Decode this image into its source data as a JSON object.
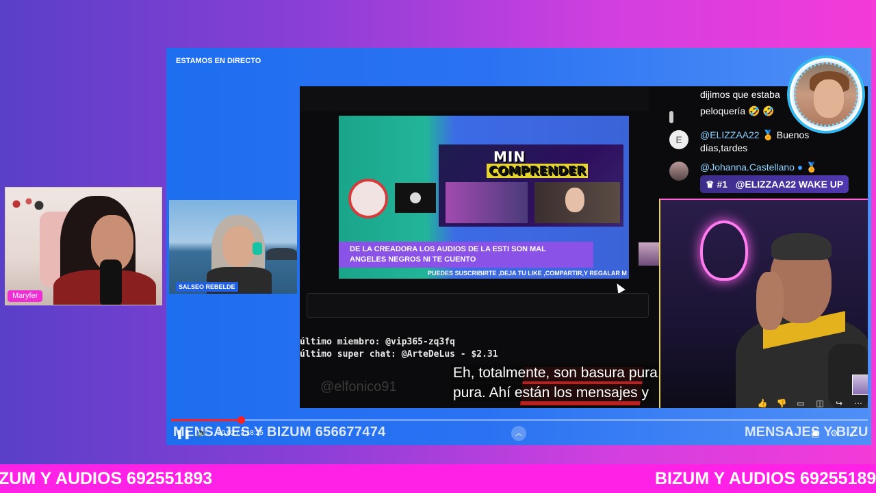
{
  "stage": {
    "live_label": "ESTAMOS EN DIRECTO"
  },
  "left_cam": {
    "name": "Maryfer"
  },
  "mid_cam": {
    "label": "SALSEO REBELDE"
  },
  "video": {
    "poster_title": "MIN",
    "poster_title2": "COMPRENDER",
    "banner_line1": "DE LA CREADORA LOS AUDIOS DE LA ESTI SON MAL",
    "banner_line2": "ANGELES NEGROS NI TE CUENTO",
    "ticker": "PUEDES SUSCRIBIRTE ,DEJA TU LIKE ,COMPARTIR,Y REGALAR M",
    "last_member": "último miembro: @vip365-zq3fq",
    "last_superchat": "último super chat: @ArteDeLus - $2.31",
    "ghost_handle": "@elfonico91",
    "subtitle_line1": "Eh, totalmente, son basura pura. Basura",
    "subtitle_line2": "pura. Ahí están los mensajes y"
  },
  "chat": {
    "msg1_line1": "dijimos que estaba",
    "msg1_line2": "peloquería 🤣 🤣",
    "msg2_avatar": "E",
    "msg2_handle": "@ELIZZAA22",
    "msg2_text": "Buenos",
    "msg2_text2": "días,tardes",
    "msg3_handle": "@Johanna.Castellano",
    "msg3_rank": "#1",
    "msg3_text": "@ELIZZAA22 WAKE UP"
  },
  "controls": {
    "time": "20:02 / 3:18:25",
    "stage_ticker": "MENSAJES Y BIZUM 656677474",
    "stage_ticker_right": "MENSAJES Y BIZU"
  },
  "progress": {
    "fraction": 0.1
  },
  "bottom_ticker": {
    "left": "ZUM Y AUDIOS 692551893",
    "right": "BIZUM Y AUDIOS 69255189"
  },
  "colors": {
    "accent_magenta": "#ff22e6",
    "stage_blue": "#2a72f2",
    "progress_red": "#ff2020"
  }
}
